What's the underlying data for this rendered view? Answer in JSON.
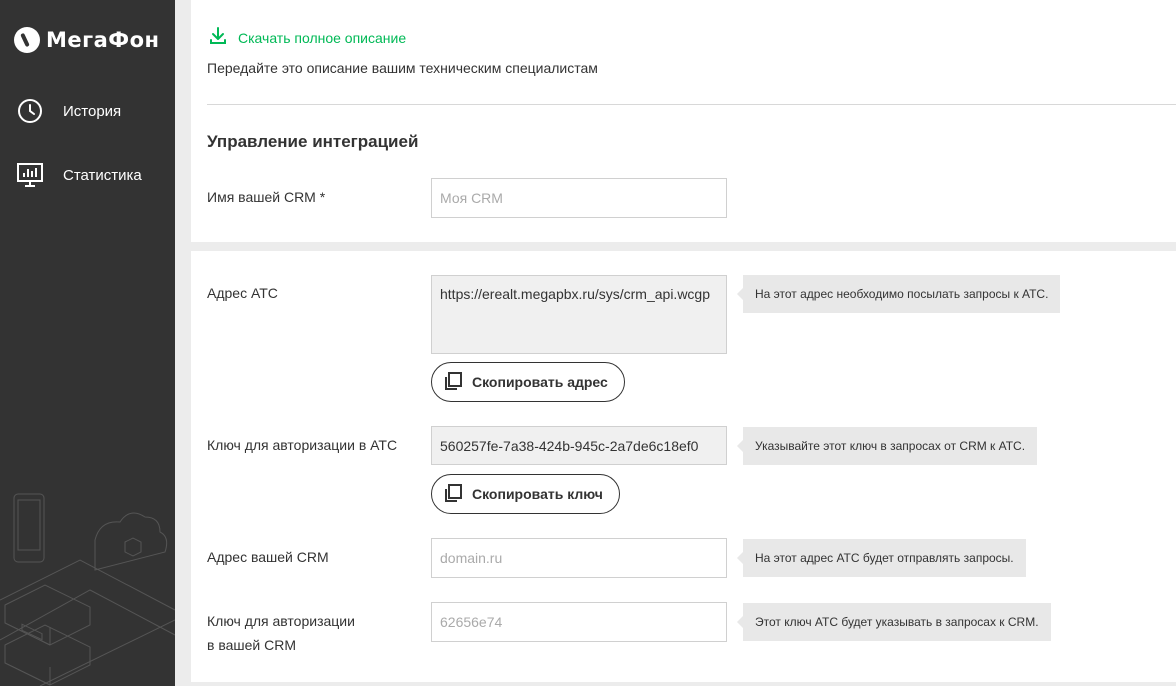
{
  "brand": {
    "name": "МегаФон"
  },
  "sidebar": {
    "items": [
      {
        "label": "История",
        "icon": "clock-icon"
      },
      {
        "label": "Статистика",
        "icon": "monitor-chart-icon"
      }
    ]
  },
  "download": {
    "label": "Скачать полное описание",
    "note": "Передайте это описание вашим техническим специалистам"
  },
  "section": {
    "title": "Управление интеграцией"
  },
  "crm_name": {
    "label": "Имя вашей CRM *",
    "placeholder": "Моя CRM"
  },
  "ats_address": {
    "label": "Адрес АТС",
    "value": "https://erealt.megapbx.ru/sys/crm_api.wcgp",
    "tip": "На этот адрес необходимо посылать запросы к АТС.",
    "copy_button": "Скопировать адрес"
  },
  "ats_key": {
    "label": "Ключ для авторизации в АТС",
    "value": "560257fe-7a38-424b-945c-2a7de6c18ef0",
    "tip": "Указывайте этот ключ в запросах от CRM к АТС.",
    "copy_button": "Скопировать ключ"
  },
  "crm_address": {
    "label": "Адрес вашей CRM",
    "placeholder": "domain.ru",
    "tip": "На этот адрес АТС будет отправлять запросы."
  },
  "crm_key": {
    "label_line1": "Ключ для авторизации",
    "label_line2": "в вашей CRM",
    "placeholder": "62656e74",
    "tip": "Этот ключ АТС будет указывать в запросах к CRM."
  },
  "colors": {
    "accent": "#00b956",
    "sidebar": "#333333"
  }
}
